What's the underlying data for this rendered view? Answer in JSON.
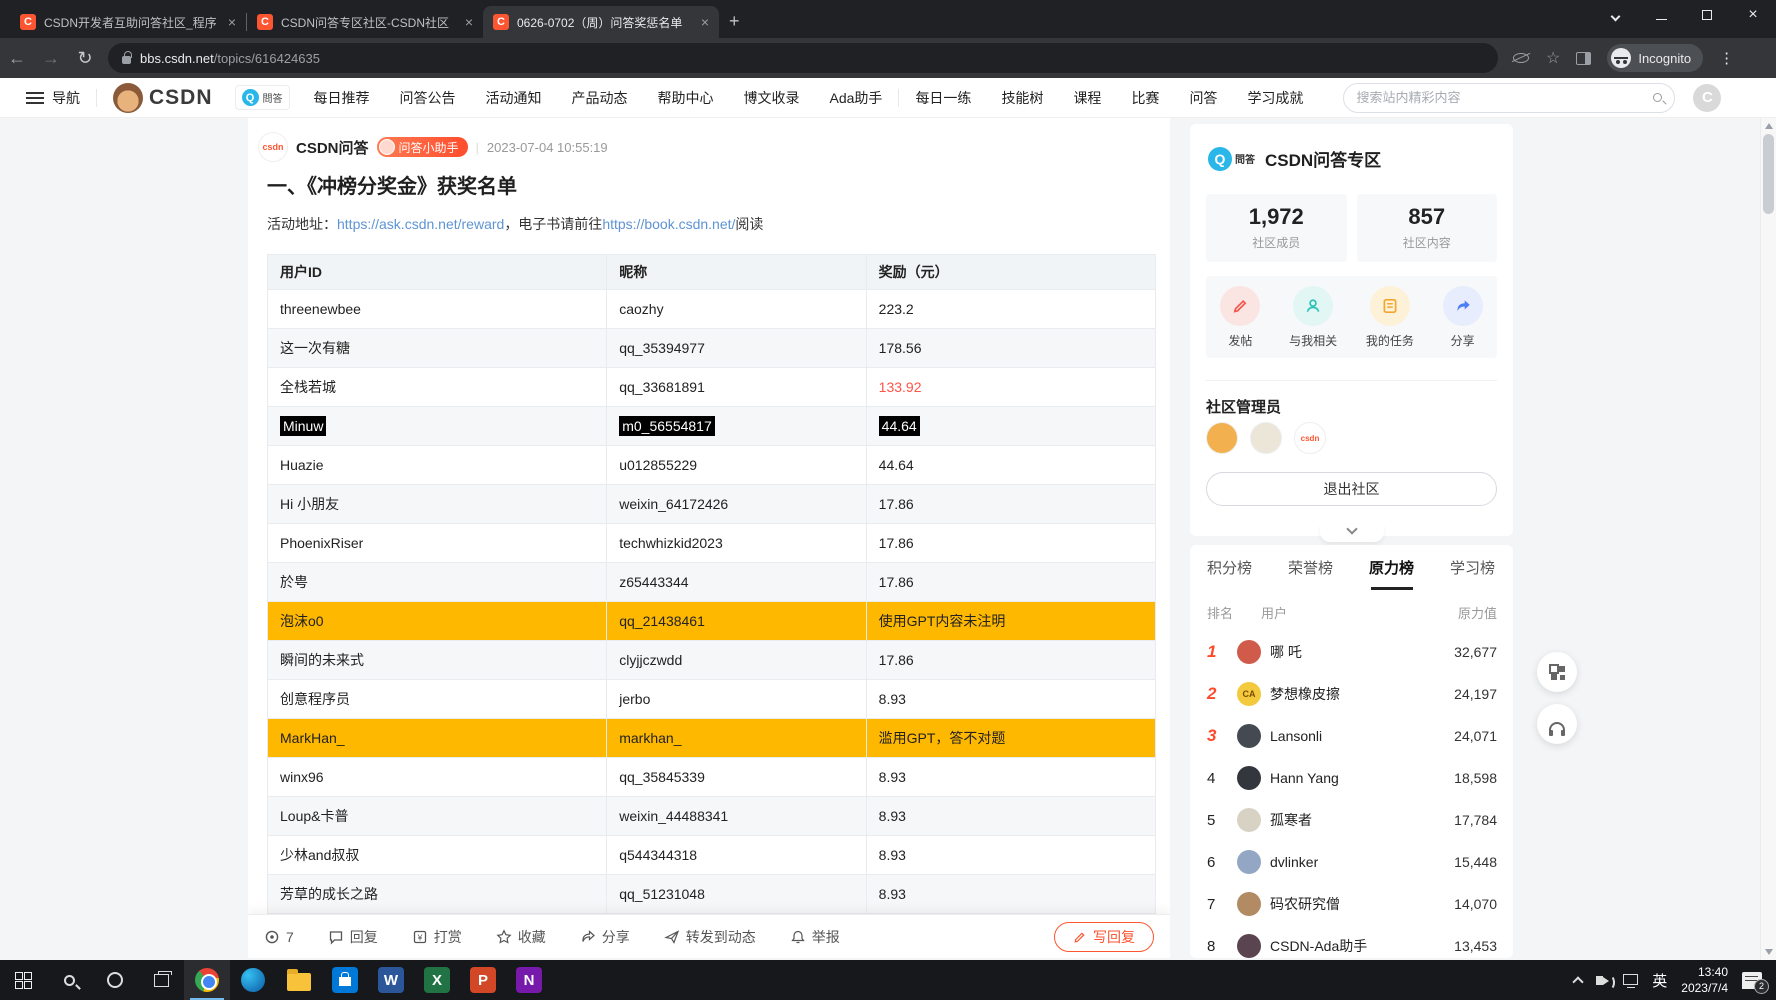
{
  "colors": {
    "accent": "#fc5531",
    "flagged_row": "#ffb800",
    "red_value": "#ff5347",
    "link_blue": "#5e94d4",
    "rank_top": "#ff4a2a"
  },
  "browser": {
    "tabs": [
      {
        "title": "CSDN开发者互助问答社区_程序",
        "active": false
      },
      {
        "title": "CSDN问答专区社区-CSDN社区",
        "active": false
      },
      {
        "title": "0626-0702（周）问答奖惩名单",
        "active": true
      }
    ],
    "url_domain": "bbs.csdn.net",
    "url_path": "/topics/616424635",
    "incognito_label": "Incognito"
  },
  "site_nav": {
    "menu_label": "导航",
    "brand": "CSDN",
    "community_badge": "問答",
    "links_left": [
      "每日推荐",
      "问答公告",
      "活动通知",
      "产品动态",
      "帮助中心",
      "博文收录",
      "Ada助手"
    ],
    "links_right": [
      "每日一练",
      "技能树",
      "课程",
      "比赛",
      "问答",
      "学习成就"
    ],
    "search_placeholder": "搜索站内精彩内容"
  },
  "post": {
    "author": "CSDN问答",
    "author_avatar_text": "csdn",
    "badge": "问答小助手",
    "timestamp": "2023-07-04 10:55:19",
    "heading": "一、《冲榜分奖金》获奖名单",
    "intro_prefix": "活动地址：",
    "link1": "https://ask.csdn.net/reward",
    "intro_mid": "，电子书请前往",
    "link2": "https://book.csdn.net/",
    "intro_suffix": "阅读"
  },
  "table": {
    "headers": [
      "用户ID",
      "昵称",
      "奖励（元）"
    ],
    "rows": [
      {
        "user": "threenewbee",
        "nick": "caozhy",
        "reward": "223.2",
        "flag": "normal"
      },
      {
        "user": "这一次有糖",
        "nick": "qq_35394977",
        "reward": "178.56",
        "flag": "normal"
      },
      {
        "user": "全栈若城",
        "nick": "qq_33681891",
        "reward": "133.92",
        "flag": "red"
      },
      {
        "user": "Minuw",
        "nick": "m0_56554817",
        "reward": "44.64",
        "flag": "selected"
      },
      {
        "user": "Huazie",
        "nick": "u012855229",
        "reward": "44.64",
        "flag": "normal"
      },
      {
        "user": "Hi 小朋友",
        "nick": "weixin_64172426",
        "reward": "17.86",
        "flag": "normal"
      },
      {
        "user": "PhoenixRiser",
        "nick": "techwhizkid2023",
        "reward": "17.86",
        "flag": "normal"
      },
      {
        "user": "於甹",
        "nick": "z65443344",
        "reward": "17.86",
        "flag": "normal"
      },
      {
        "user": "泡沫o0",
        "nick": "qq_21438461",
        "reward": "使用GPT内容未注明",
        "flag": "gpt"
      },
      {
        "user": "瞬间的未来式",
        "nick": "clyjjczwdd",
        "reward": "17.86",
        "flag": "normal"
      },
      {
        "user": "创意程序员",
        "nick": "jerbo",
        "reward": "8.93",
        "flag": "normal"
      },
      {
        "user": "MarkHan_",
        "nick": "markhan_",
        "reward": "滥用GPT，答不对题",
        "flag": "gpt"
      },
      {
        "user": "winx96",
        "nick": "qq_35845339",
        "reward": "8.93",
        "flag": "normal"
      },
      {
        "user": "Loup&卡普",
        "nick": "weixin_44488341",
        "reward": "8.93",
        "flag": "normal"
      },
      {
        "user": "少林and叔叔",
        "nick": "q544344318",
        "reward": "8.93",
        "flag": "normal"
      },
      {
        "user": "芳草的成长之路",
        "nick": "qq_51231048",
        "reward": "8.93",
        "flag": "normal"
      }
    ]
  },
  "action_bar": {
    "views": "7",
    "items": [
      {
        "label": "回复",
        "icon": "reply-icon"
      },
      {
        "label": "打赏",
        "icon": "reward-icon"
      },
      {
        "label": "收藏",
        "icon": "star-icon"
      },
      {
        "label": "分享",
        "icon": "share-icon"
      },
      {
        "label": "转发到动态",
        "icon": "forward-icon"
      },
      {
        "label": "举报",
        "icon": "report-icon"
      }
    ],
    "reply_button": "写回复"
  },
  "community_card": {
    "logo_text": "Q",
    "logo_caption": "問答",
    "title": "CSDN问答专区",
    "stats": [
      {
        "value": "1,972",
        "label": "社区成员"
      },
      {
        "value": "857",
        "label": "社区内容"
      }
    ],
    "actions": [
      {
        "label": "发帖",
        "icon": "pencil-icon",
        "bg": "#fbe5e3",
        "fg": "#f4554a"
      },
      {
        "label": "与我相关",
        "icon": "user-icon",
        "bg": "#e2f6f4",
        "fg": "#2cc2b5"
      },
      {
        "label": "我的任务",
        "icon": "tasks-icon",
        "bg": "#fdf2d8",
        "fg": "#f5a62f"
      },
      {
        "label": "分享",
        "icon": "share-icon",
        "bg": "#e7edfc",
        "fg": "#4d7df7"
      }
    ],
    "admins_title": "社区管理员",
    "admins": [
      {
        "color": "#f2b04e",
        "text": ""
      },
      {
        "color": "#ece6d8",
        "text": ""
      },
      {
        "color": "#ffffff",
        "text": "csdn"
      }
    ],
    "exit_button": "退出社区"
  },
  "ranking_card": {
    "tabs": [
      {
        "label": "积分榜",
        "active": false
      },
      {
        "label": "荣誉榜",
        "active": false
      },
      {
        "label": "原力榜",
        "active": true
      },
      {
        "label": "学习榜",
        "active": false
      }
    ],
    "col_rank": "排名",
    "col_user": "用户",
    "col_value": "原力值",
    "rows": [
      {
        "rank": "1",
        "name": "哪 吒",
        "value": "32,677",
        "avatar": "#d05b4b",
        "initials": ""
      },
      {
        "rank": "2",
        "name": "梦想橡皮擦",
        "value": "24,197",
        "avatar": "#f3c93e",
        "initials": "CA"
      },
      {
        "rank": "3",
        "name": "Lansonli",
        "value": "24,071",
        "avatar": "#454a52",
        "initials": ""
      },
      {
        "rank": "4",
        "name": "Hann Yang",
        "value": "18,598",
        "avatar": "#33373d",
        "initials": ""
      },
      {
        "rank": "5",
        "name": "孤寒者",
        "value": "17,784",
        "avatar": "#d8d2c4",
        "initials": ""
      },
      {
        "rank": "6",
        "name": "dvlinker",
        "value": "15,448",
        "avatar": "#93a7c4",
        "initials": ""
      },
      {
        "rank": "7",
        "name": "码农研究僧",
        "value": "14,070",
        "avatar": "#b28a64",
        "initials": ""
      },
      {
        "rank": "8",
        "name": "CSDN-Ada助手",
        "value": "13,453",
        "avatar": "#5a4450",
        "initials": ""
      }
    ]
  },
  "taskbar": {
    "apps": [
      {
        "name": "chrome",
        "active": true
      },
      {
        "name": "edge",
        "active": false
      },
      {
        "name": "file-explorer",
        "active": false
      },
      {
        "name": "store",
        "active": false
      },
      {
        "name": "word",
        "letter": "W",
        "color": "#2b579a",
        "active": false
      },
      {
        "name": "excel",
        "letter": "X",
        "color": "#217346",
        "active": false
      },
      {
        "name": "powerpoint",
        "letter": "P",
        "color": "#d24726",
        "active": false
      },
      {
        "name": "onenote",
        "letter": "N",
        "color": "#7719aa",
        "active": false
      }
    ],
    "ime": "英",
    "time": "13:40",
    "date": "2023/7/4",
    "notification_badge": "2"
  }
}
